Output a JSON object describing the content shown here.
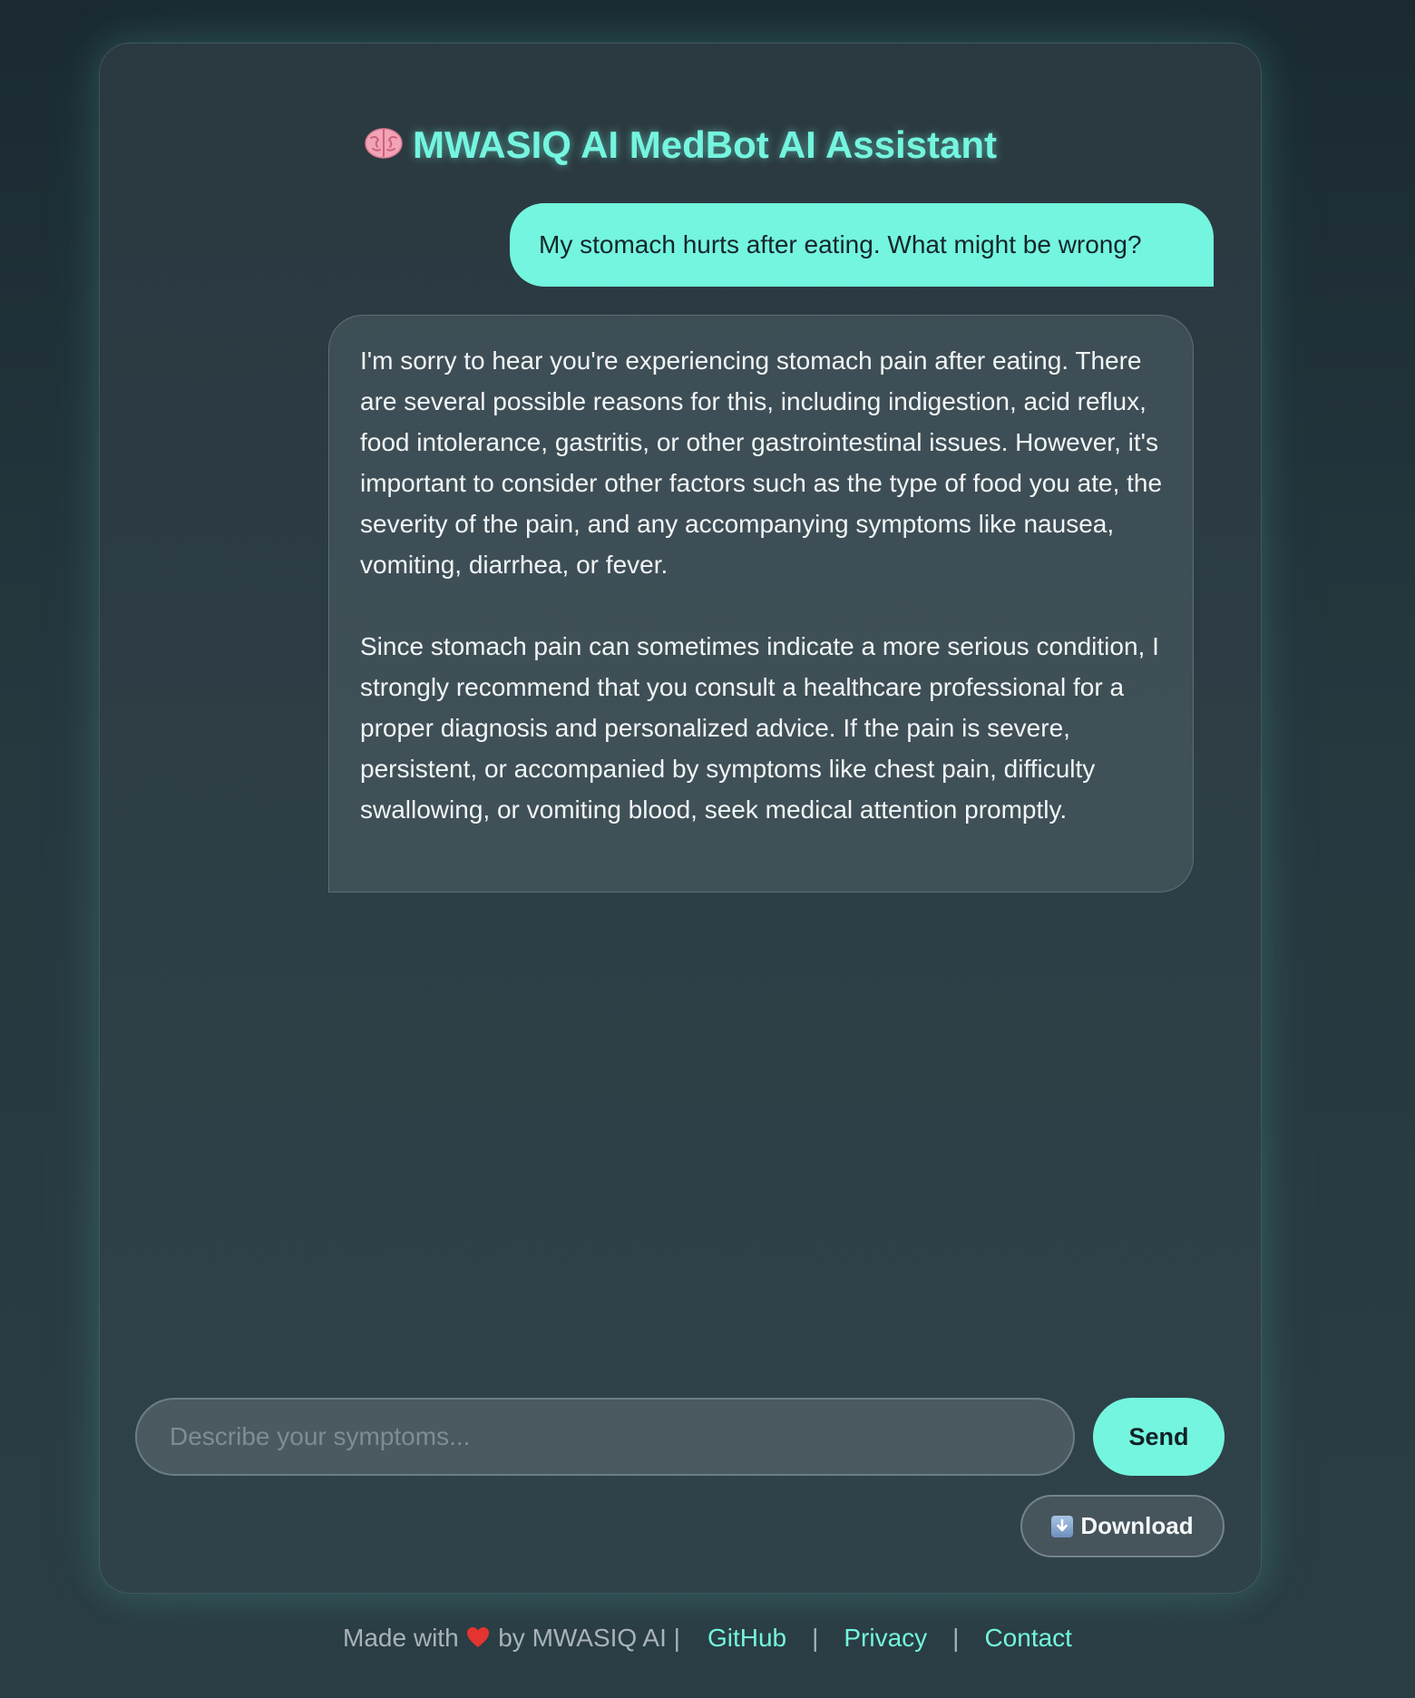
{
  "app": {
    "title": "MWASIQ AI MedBot AI Assistant",
    "title_icon": "brain-icon",
    "accent_color": "#74f5df"
  },
  "chat": {
    "messages": [
      {
        "role": "user",
        "text": "My stomach hurts after eating. What might be wrong?"
      },
      {
        "role": "assistant",
        "paragraphs": [
          "I'm sorry to hear you're experiencing stomach pain after eating. There are several possible reasons for this, including indigestion, acid reflux, food intolerance, gastritis, or other gastrointestinal issues. However, it's important to consider other factors such as the type of food you ate, the severity of the pain, and any accompanying symptoms like nausea, vomiting, diarrhea, or fever.",
          "Since stomach pain can sometimes indicate a more serious condition, I strongly recommend that you consult a healthcare professional for a proper diagnosis and personalized advice. If the pain is severe, persistent, or accompanied by symptoms like chest pain, difficulty swallowing, or vomiting blood, seek medical attention promptly."
        ]
      }
    ]
  },
  "composer": {
    "placeholder": "Describe your symptoms...",
    "value": "",
    "send_label": "Send",
    "download_label": "Download",
    "download_icon": "download-arrow-icon"
  },
  "footer": {
    "made_with_prefix": "Made with",
    "heart_icon": "heart-icon",
    "made_with_suffix": "by MWASIQ AI |",
    "links": {
      "github": "GitHub",
      "privacy": "Privacy",
      "contact": "Contact"
    },
    "separator": "|"
  }
}
